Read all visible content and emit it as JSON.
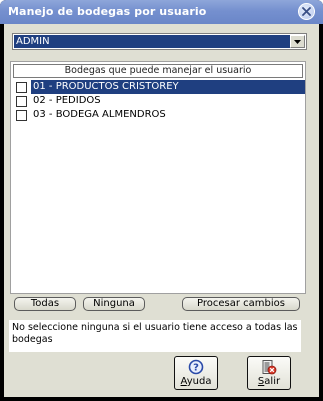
{
  "window": {
    "title": "Manejo de bodegas por usuario"
  },
  "user_select": {
    "value": "ADMIN"
  },
  "warehouses": {
    "header": "Bodegas que puede manejar el usuario",
    "items": [
      {
        "label": "01 - PRODUCTOS CRISTOREY",
        "checked": false,
        "selected": true
      },
      {
        "label": "02 - PEDIDOS",
        "checked": false,
        "selected": false
      },
      {
        "label": "03 - BODEGA ALMENDROS",
        "checked": false,
        "selected": false
      }
    ]
  },
  "buttons": {
    "all": "Todas",
    "none": "Ninguna",
    "process": "Procesar cambios",
    "help_pre": "",
    "help_ul": "A",
    "help_post": "yuda",
    "exit_pre": "",
    "exit_ul": "S",
    "exit_post": "alir"
  },
  "note": "No seleccione ninguna si el usuario tiene acceso a todas las bodegas",
  "colors": {
    "title_bar": "#7590cf",
    "selection": "#1f3f80",
    "panel": "#dfdfd3"
  },
  "icons": {
    "close": "close-icon",
    "dropdown": "chevron-down-icon",
    "help": "help-icon",
    "exit": "exit-icon"
  }
}
